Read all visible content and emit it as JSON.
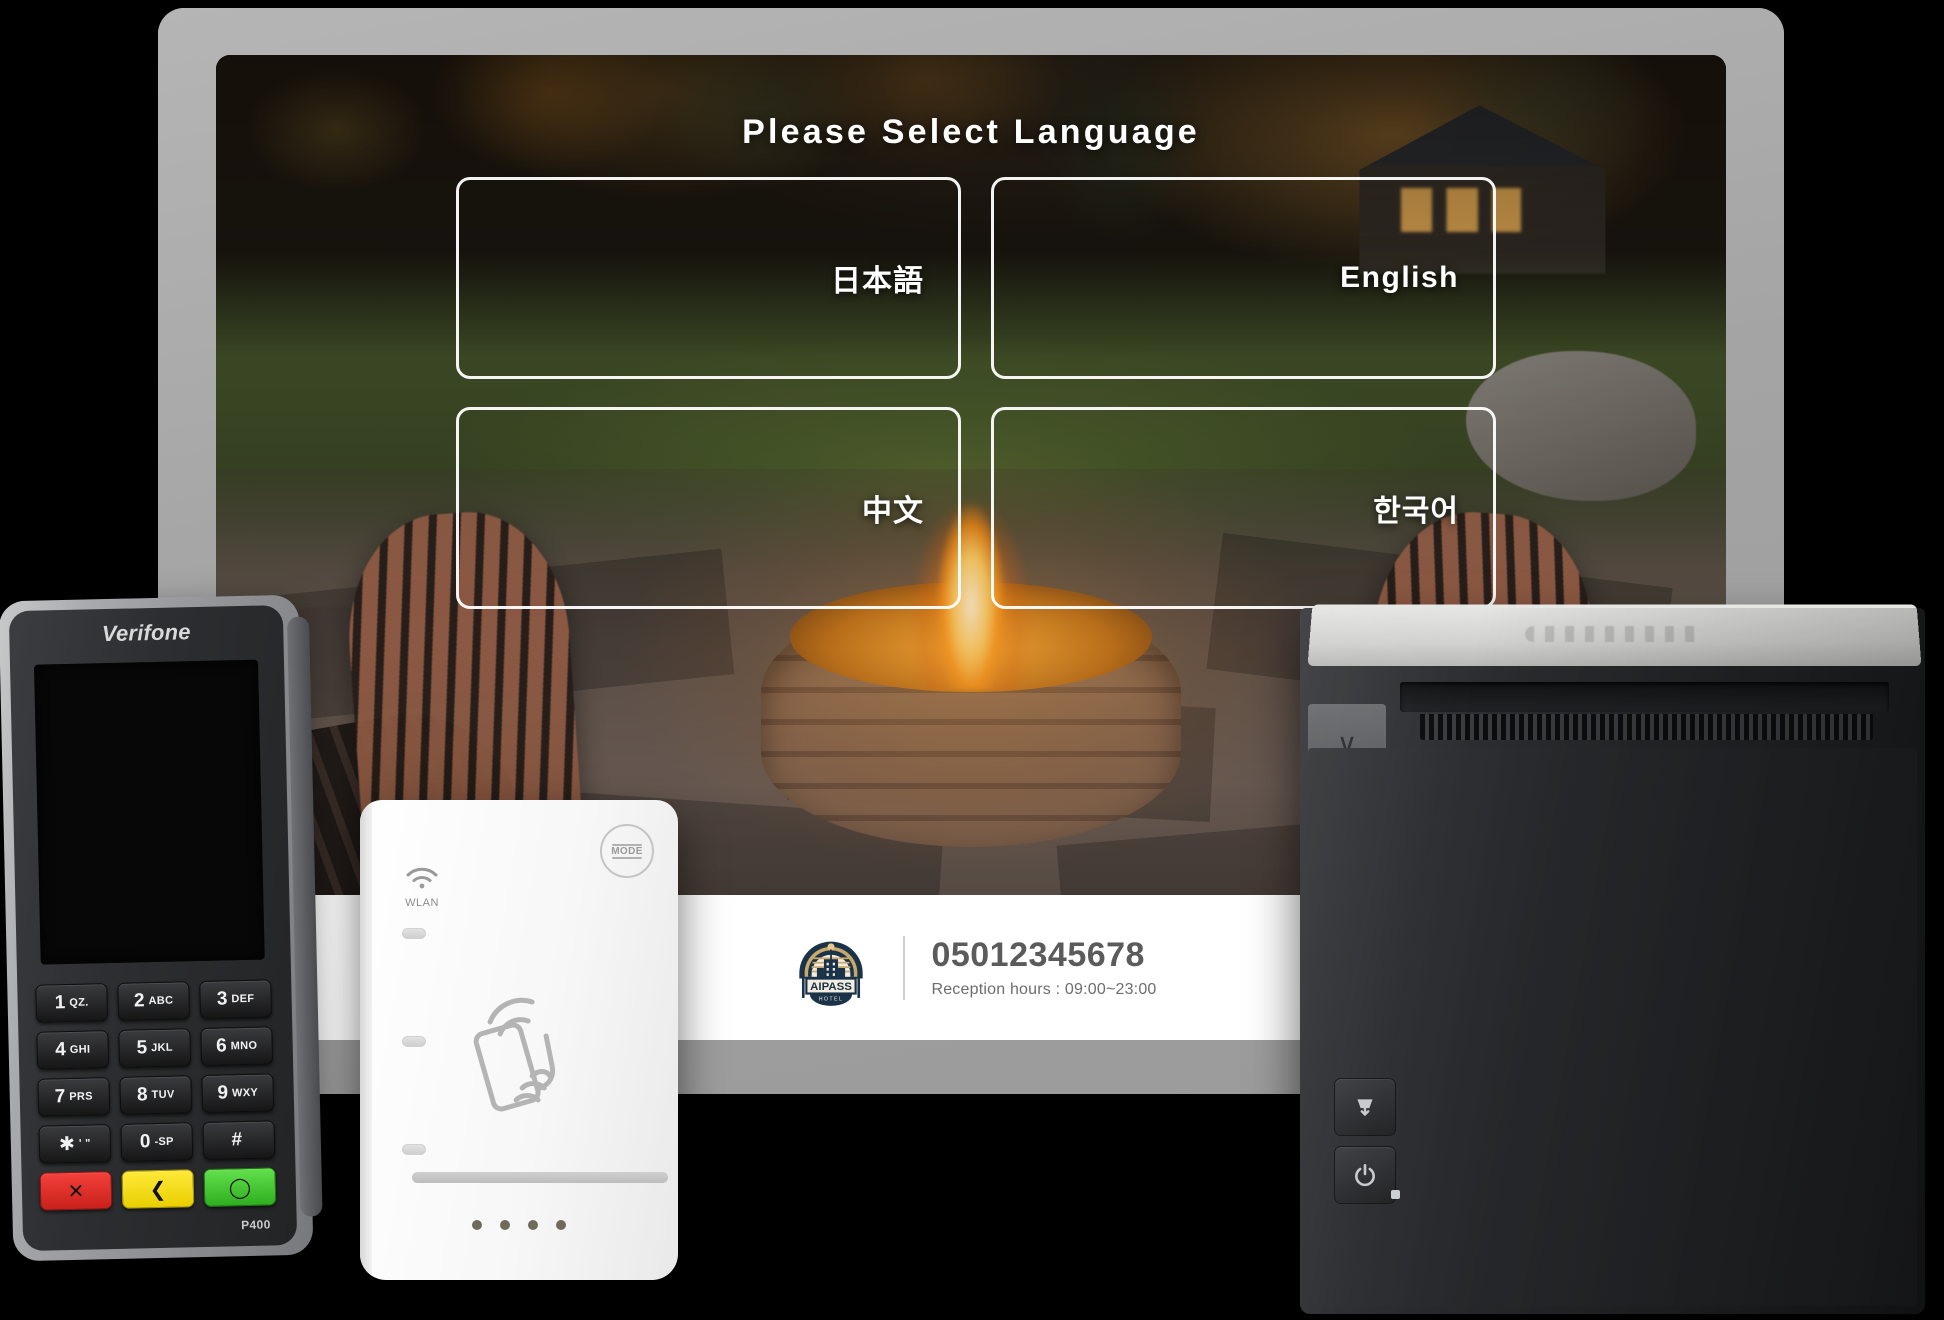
{
  "scene": {
    "description": "Hotel self check-in kiosk hardware set: tablet showing language selection screen, Verifone P400 payment terminal, white NFC/WLAN card reader, thermal receipt printer"
  },
  "kiosk": {
    "title": "Please Select Language",
    "languages": [
      {
        "id": "ja",
        "label": "日本語",
        "script": "cjk"
      },
      {
        "id": "en",
        "label": "English",
        "script": "latin"
      },
      {
        "id": "zh",
        "label": "中文",
        "script": "cjk"
      },
      {
        "id": "ko",
        "label": "한국어",
        "script": "cjk"
      }
    ],
    "footer": {
      "logo": {
        "name": "AIPASS",
        "subtitle": "HOTEL",
        "colors": {
          "badge": "#1a3349",
          "accent": "#c9a96b",
          "cream": "#f3ece0"
        }
      },
      "phone": "05012345678",
      "hours": "Reception hours : 09:00~23:00"
    }
  },
  "pos_terminal": {
    "brand": "Verifone",
    "model": "P400",
    "keys": [
      {
        "num": "1",
        "letters": "QZ."
      },
      {
        "num": "2",
        "letters": "ABC"
      },
      {
        "num": "3",
        "letters": "DEF"
      },
      {
        "num": "4",
        "letters": "GHI"
      },
      {
        "num": "5",
        "letters": "JKL"
      },
      {
        "num": "6",
        "letters": "MNO"
      },
      {
        "num": "7",
        "letters": "PRS"
      },
      {
        "num": "8",
        "letters": "TUV"
      },
      {
        "num": "9",
        "letters": "WXY"
      },
      {
        "num": "✱",
        "letters": "' \""
      },
      {
        "num": "0",
        "letters": "-SP"
      },
      {
        "num": "#",
        "letters": ""
      }
    ],
    "function_keys": [
      {
        "id": "cancel",
        "glyph": "✕",
        "color": "#e63228"
      },
      {
        "id": "back",
        "glyph": "❮",
        "color": "#ffe400"
      },
      {
        "id": "enter",
        "glyph": "◯",
        "color": "#4ec73b"
      }
    ]
  },
  "card_reader": {
    "mode_button_label": "MODE",
    "wlan_label": "WLAN",
    "indicator_count": 3,
    "contact_dots": 4
  },
  "printer": {
    "buttons": [
      {
        "id": "feed",
        "icon": "paper-feed-icon"
      },
      {
        "id": "power",
        "icon": "power-icon"
      }
    ]
  }
}
